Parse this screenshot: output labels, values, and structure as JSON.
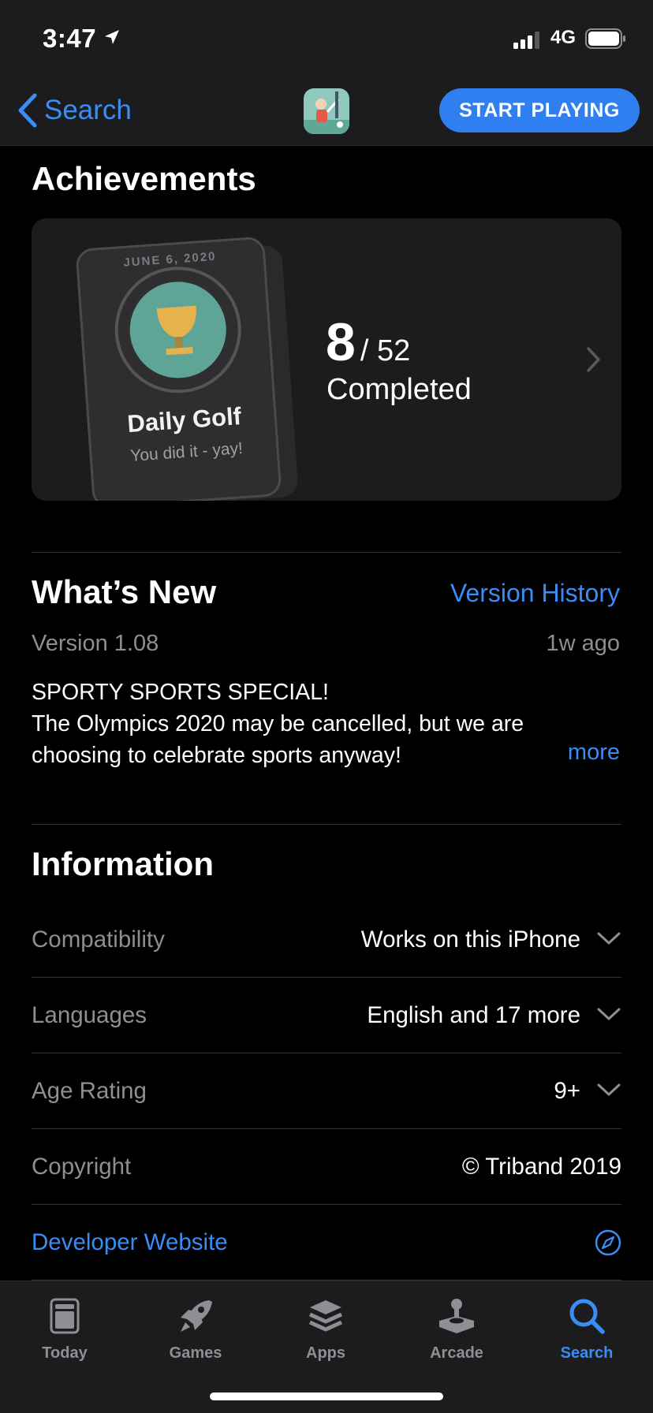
{
  "status_bar": {
    "time": "3:47",
    "network": "4G"
  },
  "nav": {
    "back_label": "Search",
    "cta_label": "START PLAYING"
  },
  "achievements": {
    "title": "Achievements",
    "badge_date": "JUNE 6, 2020",
    "badge_name": "Daily Golf",
    "badge_subtitle": "You did it - yay!",
    "completed": "8",
    "total": "/ 52",
    "completed_label": "Completed"
  },
  "whats_new": {
    "title": "What’s New",
    "history_link": "Version History",
    "version": "Version 1.08",
    "age": "1w ago",
    "notes": [
      "SPORTY SPORTS SPECIAL!",
      "The Olympics 2020 may be cancelled, but we are",
      "choosing to celebrate sports anyway!"
    ],
    "more_label": "more"
  },
  "information": {
    "title": "Information",
    "rows": [
      {
        "label": "Compatibility",
        "value": "Works on this iPhone"
      },
      {
        "label": "Languages",
        "value": "English and 17 more"
      },
      {
        "label": "Age Rating",
        "value": "9+"
      },
      {
        "label": "Copyright",
        "value": "© Triband 2019"
      }
    ],
    "developer_link": "Developer Website"
  },
  "tabs": [
    {
      "label": "Today",
      "icon": "today-icon"
    },
    {
      "label": "Games",
      "icon": "rocket-icon"
    },
    {
      "label": "Apps",
      "icon": "layers-icon"
    },
    {
      "label": "Arcade",
      "icon": "joystick-icon"
    },
    {
      "label": "Search",
      "icon": "search-icon",
      "active": true
    }
  ],
  "colors": {
    "accent": "#3a8df5",
    "background": "#000000",
    "card": "#1c1c1e",
    "cta": "#2f7ff0",
    "secondary_text": "#8e8e93"
  }
}
